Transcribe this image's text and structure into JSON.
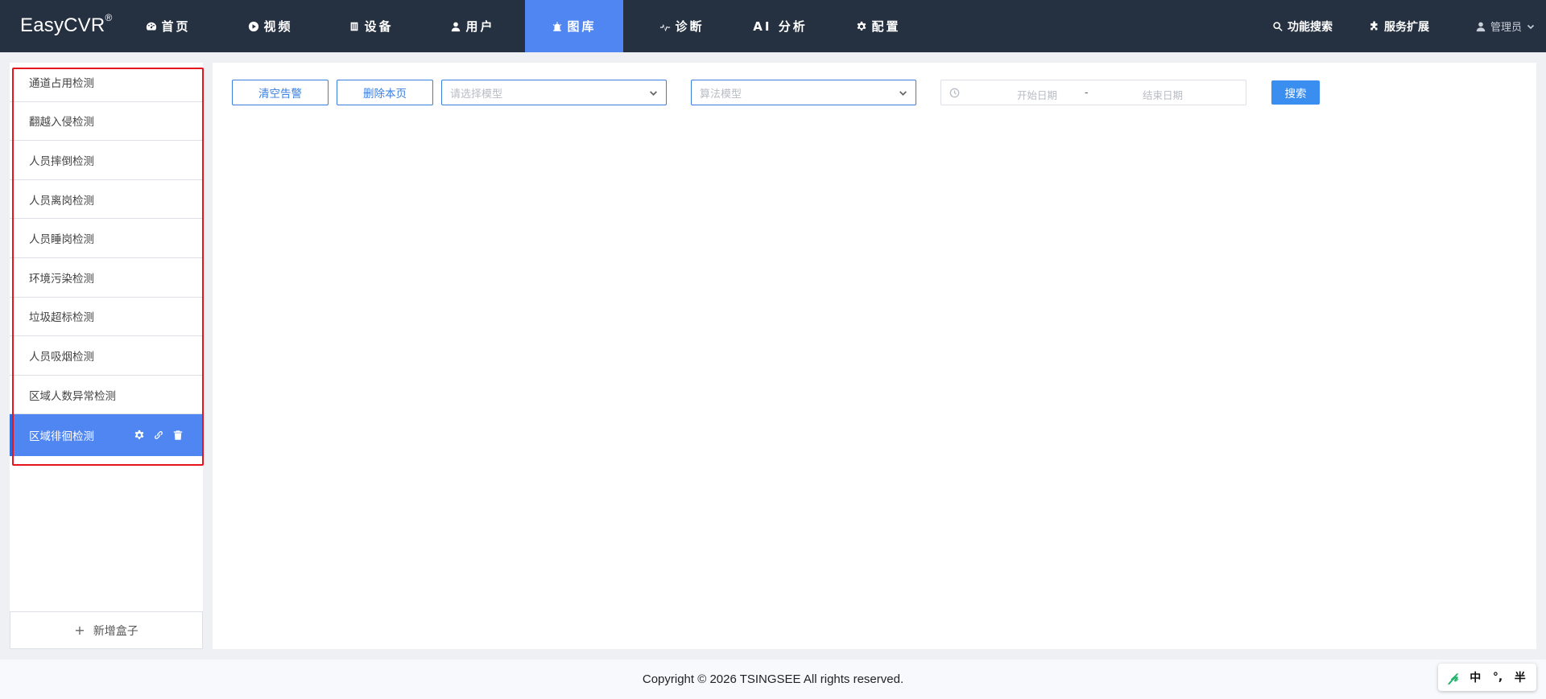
{
  "app": {
    "brand": "EasyCVR",
    "brand_mark": "®"
  },
  "nav": {
    "items": [
      {
        "label": "首页",
        "icon": "dashboard-icon",
        "active": false
      },
      {
        "label": "视频",
        "icon": "play-circle-icon",
        "active": false
      },
      {
        "label": "设备",
        "icon": "device-icon",
        "active": false
      },
      {
        "label": "用户",
        "icon": "user-icon",
        "active": false
      },
      {
        "label": "图库",
        "icon": "alarm-icon",
        "active": true
      },
      {
        "label": "诊断",
        "icon": "pulse-icon",
        "active": false
      },
      {
        "label": "AI 分析",
        "icon": "",
        "active": false
      },
      {
        "label": "配置",
        "icon": "gear-icon",
        "active": false
      }
    ],
    "search_label": "功能搜索",
    "extend_label": "服务扩展",
    "user_label": "管理员"
  },
  "sidebar": {
    "items": [
      {
        "label": "通道占用检测"
      },
      {
        "label": "翻越入侵检测"
      },
      {
        "label": "人员摔倒检测"
      },
      {
        "label": "人员离岗检测"
      },
      {
        "label": "人员睡岗检测"
      },
      {
        "label": "环境污染检测"
      },
      {
        "label": "垃圾超标检测"
      },
      {
        "label": "人员吸烟检测"
      },
      {
        "label": "区域人数异常检测"
      },
      {
        "label": "区域徘徊检测",
        "active": true
      }
    ],
    "add_label": "新增盒子",
    "add_symbol": "+"
  },
  "toolbar": {
    "clear_label": "清空告警",
    "delete_page_label": "删除本页",
    "model_placeholder": "请选择模型",
    "algo_placeholder": "算法模型",
    "start_date_placeholder": "开始日期",
    "date_separator": "-",
    "end_date_placeholder": "结束日期",
    "search_label": "搜索"
  },
  "footer": {
    "copyright": "Copyright © 2026 TSINGSEE All rights reserved."
  },
  "ime": {
    "lang": "中",
    "punct": "°,",
    "width": "半"
  },
  "colors": {
    "topbar_bg": "#253041",
    "accent": "#4f86f2",
    "primary_button": "#3a8ef0",
    "highlight_border": "#e8141b"
  }
}
